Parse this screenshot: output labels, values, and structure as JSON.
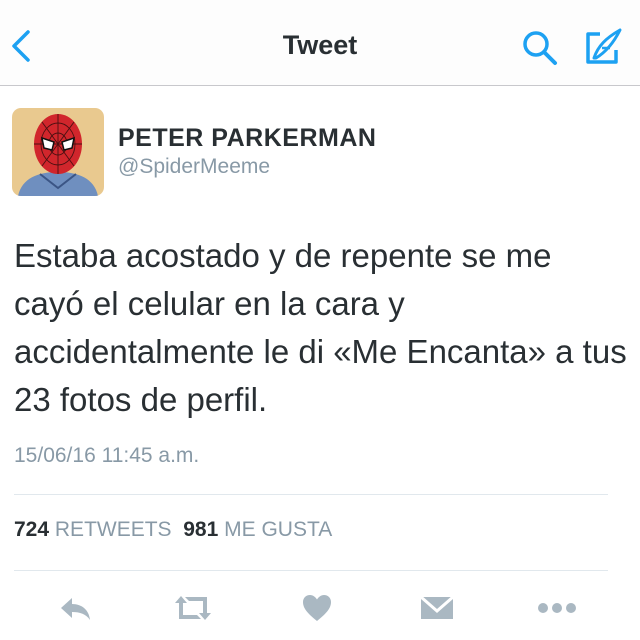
{
  "nav": {
    "title": "Tweet",
    "back_icon": "chevron-left-icon",
    "search_icon": "search-icon",
    "compose_icon": "compose-icon",
    "accent_color": "#1da1f2"
  },
  "author": {
    "display_name": "PETER PARKERMAN",
    "handle": "@SpiderMeeme"
  },
  "tweet": {
    "text": "Estaba acostado y de repente se me cayó el celular en la cara y accidentalmente le di «Me Encanta» a tus 23 fotos de perfil.",
    "timestamp": "15/06/16 11:45 a.m."
  },
  "stats": {
    "retweets_count": "724",
    "retweets_label": "RETWEETS",
    "likes_count": "981",
    "likes_label": "ME GUSTA"
  },
  "actions": [
    "reply-icon",
    "retweet-icon",
    "heart-icon",
    "dm-icon",
    "more-icon"
  ],
  "colors": {
    "text": "#292f33",
    "secondary": "#8899a6",
    "action_icon": "#aab8c2"
  }
}
